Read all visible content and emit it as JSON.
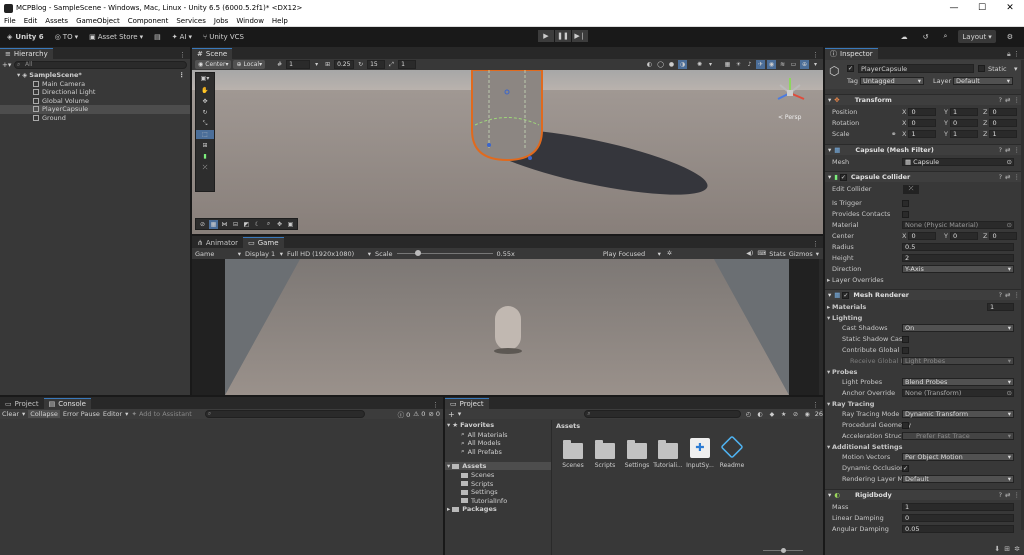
{
  "window": {
    "title": "MCPBlog - SampleScene - Windows, Mac, Linux - Unity 6.5 (6000.5.2f1)* <DX12>",
    "controls": [
      "—",
      "☐",
      "✕"
    ]
  },
  "menu": [
    "File",
    "Edit",
    "Assets",
    "GameObject",
    "Component",
    "Services",
    "Jobs",
    "Window",
    "Help"
  ],
  "toolbar": {
    "unity_label": "Unity 6",
    "account_label": "TO",
    "asset_store_label": "Asset Store",
    "ai_label": "AI",
    "vcs_label": "Unity VCS",
    "layout_label": "Layout"
  },
  "hierarchy": {
    "tab_label": "Hierarchy",
    "search_placeholder": "All",
    "scene_name": "SampleScene*",
    "items": [
      "Main Camera",
      "Directional Light",
      "Global Volume",
      "PlayerCapsule",
      "Ground"
    ]
  },
  "scene": {
    "tab_label": "Scene",
    "pivot_label": "Center",
    "space_label": "Local",
    "grid_count": "1",
    "snap_value": "0.25",
    "rotate_snap": "15",
    "scale_snap": "1",
    "persp_label": "< Persp"
  },
  "game": {
    "tabs": [
      "Animator",
      "Game"
    ],
    "display_mode": "Game",
    "display": "Display 1",
    "resolution": "Full HD (1920x1080)",
    "scale_label": "Scale",
    "scale_value": "0.55x",
    "scale_fraction": 0.22,
    "play_mode": "Play Focused",
    "stats_label": "Stats",
    "gizmos_label": "Gizmos"
  },
  "console": {
    "tabs": [
      "Project",
      "Console"
    ],
    "clear_label": "Clear",
    "collapse_label": "Collapse",
    "error_pause_label": "Error Pause",
    "editor_label": "Editor",
    "assistant_label": "Add to Assistant",
    "error_count": "0",
    "warning_count": "0",
    "log_count": "0"
  },
  "project": {
    "tab_label": "Project",
    "favorites_label": "Favorites",
    "favorites": [
      "All Materials",
      "All Models",
      "All Prefabs"
    ],
    "assets_label": "Assets",
    "asset_children": [
      "Scenes",
      "Scripts",
      "Settings",
      "TutorialInfo"
    ],
    "packages_label": "Packages",
    "grid_header": "Assets",
    "grid_items": [
      "Scenes",
      "Scripts",
      "Settings",
      "Tutoriali...",
      "InputSy...",
      "Readme"
    ],
    "item_count": "26"
  },
  "inspector": {
    "tab_label": "Inspector",
    "object_name": "PlayerCapsule",
    "static_label": "Static",
    "tag_label": "Tag",
    "tag_value": "Untagged",
    "layer_label": "Layer",
    "layer_value": "Default",
    "transform": {
      "title": "Transform",
      "position_label": "Position",
      "position": [
        "0",
        "1",
        "0"
      ],
      "rotation_label": "Rotation",
      "rotation": [
        "0",
        "0",
        "0"
      ],
      "scale_label": "Scale",
      "scale": [
        "1",
        "1",
        "1"
      ]
    },
    "mesh_filter": {
      "title": "Capsule (Mesh Filter)",
      "mesh_label": "Mesh",
      "mesh_value": "Capsule"
    },
    "capsule_collider": {
      "title": "Capsule Collider",
      "edit_label": "Edit Collider",
      "is_trigger_label": "Is Trigger",
      "provides_contacts_label": "Provides Contacts",
      "material_label": "Material",
      "material_value": "None (Physic Material)",
      "center_label": "Center",
      "center": [
        "0",
        "0",
        "0"
      ],
      "radius_label": "Radius",
      "radius": "0.5",
      "height_label": "Height",
      "height": "2",
      "direction_label": "Direction",
      "direction": "Y-Axis",
      "layer_overrides_label": "Layer Overrides"
    },
    "mesh_renderer": {
      "title": "Mesh Renderer",
      "materials_label": "Materials",
      "materials_count": "1",
      "lighting_label": "Lighting",
      "cast_shadows_label": "Cast Shadows",
      "cast_shadows": "On",
      "static_shadow_label": "Static Shadow Caste",
      "contribute_gi_label": "Contribute Global Illi",
      "receive_gi_label": "Receive Global Illi",
      "receive_gi": "Light Probes",
      "probes_label": "Probes",
      "light_probes_label": "Light Probes",
      "light_probes": "Blend Probes",
      "anchor_override_label": "Anchor Override",
      "anchor_override": "None (Transform)",
      "ray_tracing_label": "Ray Tracing",
      "ray_tracing_mode_label": "Ray Tracing Mode",
      "ray_tracing_mode": "Dynamic Transform",
      "procedural_geometry_label": "Procedural Geometry",
      "acceleration_label": "Acceleration Structu",
      "acceleration": "Prefer Fast Trace",
      "additional_label": "Additional Settings",
      "motion_vectors_label": "Motion Vectors",
      "motion_vectors": "Per Object Motion",
      "dynamic_occlusion_label": "Dynamic Occlusion",
      "rendering_layer_label": "Rendering Layer Mas",
      "rendering_layer": "Default"
    },
    "rigidbody": {
      "title": "Rigidbody",
      "mass_label": "Mass",
      "mass": "1",
      "linear_damping_label": "Linear Damping",
      "linear_damping": "0",
      "angular_damping_label": "Angular Damping",
      "angular_damping": "0.05"
    }
  }
}
